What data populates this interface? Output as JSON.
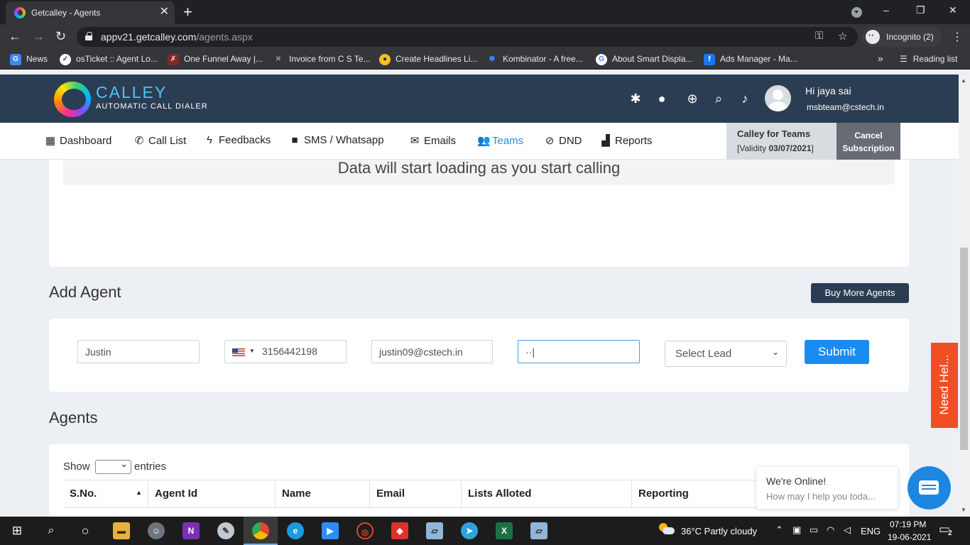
{
  "browser": {
    "tab_title": "Getcalley - Agents",
    "tab_close": "✕",
    "new_tab": "+",
    "url_host": "appv21.getcalley.com",
    "url_path": "/agents.aspx",
    "incognito_label": "Incognito (2)",
    "window_controls": {
      "minimize": "–",
      "maximize": "❐",
      "close": "✕"
    }
  },
  "bookmarks": [
    {
      "label": "News",
      "icon": "google-news-icon",
      "color": "#4285f4"
    },
    {
      "label": "osTicket :: Agent Lo...",
      "icon": "osticket-icon",
      "color": "#ffffff"
    },
    {
      "label": "One Funnel Away |...",
      "icon": "funnel-icon",
      "color": "#e53935"
    },
    {
      "label": "Invoice from C S Te...",
      "icon": "invoice-icon",
      "color": "#9aa0a6"
    },
    {
      "label": "Create Headlines Li...",
      "icon": "headline-icon",
      "color": "#f6c026"
    },
    {
      "label": "Kombinator - A free...",
      "icon": "kombinator-icon",
      "color": "#3b82f6"
    },
    {
      "label": "About Smart Displa...",
      "icon": "google-icon",
      "color": "#ffffff"
    },
    {
      "label": "Ads Manager - Ma...",
      "icon": "facebook-icon",
      "color": "#1877f2"
    }
  ],
  "bookmarks_overflow": "»",
  "reading_list": "Reading list",
  "header": {
    "brand_name": "CALLEY",
    "brand_tagline": "AUTOMATIC CALL DIALER",
    "greeting": "Hi jaya sai",
    "email": "msbteam@cstech.in",
    "icons": [
      "android-icon",
      "apple-icon",
      "support-icon",
      "search-icon",
      "bell-icon"
    ]
  },
  "nav": {
    "items": [
      {
        "label": "Dashboard",
        "icon": "dashboard-icon",
        "active": false
      },
      {
        "label": "Call List",
        "icon": "phone-icon",
        "active": false
      },
      {
        "label": "Feedbacks",
        "icon": "bolt-icon",
        "active": false
      },
      {
        "label": "SMS / Whatsapp",
        "icon": "message-icon",
        "active": false
      },
      {
        "label": "Emails",
        "icon": "envelope-icon",
        "active": false
      },
      {
        "label": "Teams",
        "icon": "users-icon",
        "active": true
      },
      {
        "label": "DND",
        "icon": "ban-icon",
        "active": false
      },
      {
        "label": "Reports",
        "icon": "reports-icon",
        "active": false
      }
    ],
    "plan_title": "Calley for Teams",
    "plan_validity_prefix": "[Validity ",
    "plan_validity_date": "03/07/2021",
    "plan_validity_suffix": "]",
    "cancel_line1": "Cancel",
    "cancel_line2": "Subscription"
  },
  "main": {
    "loading_message": "Data will start loading as you start calling",
    "add_agent_title": "Add Agent",
    "buy_more_label": "Buy More Agents",
    "form": {
      "name_value": "Justin",
      "phone_value": "3156442198",
      "email_value": "justin09@cstech.in",
      "password_value": "··|",
      "lead_select": "Select Lead",
      "submit_label": "Submit"
    },
    "agents_title": "Agents",
    "show_label": "Show",
    "entries_label": "entries",
    "table_headers": [
      "S.No.",
      "Agent Id",
      "Name",
      "Email",
      "Lists Alloted",
      "Reporting"
    ]
  },
  "widgets": {
    "need_help": "Need Hel...",
    "chat_title": "We're Online!",
    "chat_subtitle": "How may I help you toda..."
  },
  "taskbar": {
    "weather": "36°C  Partly cloudy",
    "language": "ENG",
    "time": "07:19 PM",
    "date": "19-06-2021",
    "notification_count": "2"
  },
  "colors": {
    "header_bg": "#2b3d52",
    "accent_blue": "#1a8cf0",
    "active_nav": "#2a8ee0",
    "need_help_bg": "#f04e23"
  }
}
